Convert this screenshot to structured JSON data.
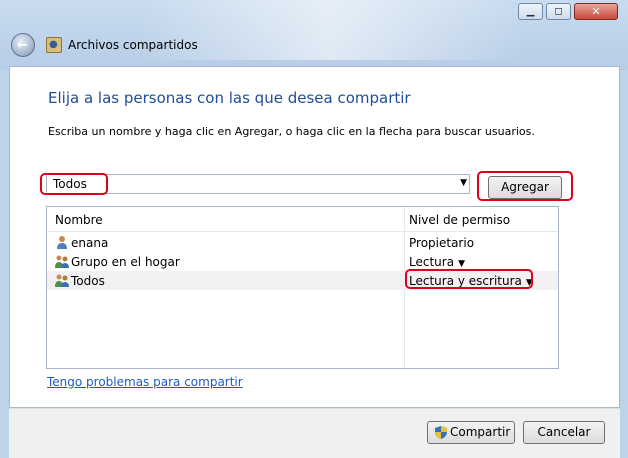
{
  "window": {
    "title": "Archivos compartidos",
    "buttons": {
      "minimize": "▁",
      "maximize": "◻",
      "close": "✕"
    }
  },
  "dialog": {
    "heading": "Elija a las personas con las que desea compartir",
    "description": "Escriba un nombre y haga clic en Agregar, o haga clic en la flecha para buscar usuarios.",
    "name_input": {
      "value": "Todos"
    },
    "add_button": "Agregar",
    "list": {
      "columns": {
        "name": "Nombre",
        "permission": "Nivel de permiso"
      },
      "rows": [
        {
          "icon": "user-icon",
          "name": "enana",
          "permission": "Propietario",
          "has_dropdown": false
        },
        {
          "icon": "group-icon",
          "name": "Grupo en el hogar",
          "permission": "Lectura",
          "has_dropdown": true,
          "caret": "▼"
        },
        {
          "icon": "group-icon",
          "name": "Todos",
          "permission": "Lectura y escritura",
          "has_dropdown": true,
          "caret": "▼"
        }
      ]
    },
    "help_link": "Tengo problemas para compartir"
  },
  "footer": {
    "share_button": "Compartir",
    "cancel_button": "Cancelar"
  },
  "colors": {
    "heading": "#1e4e9a",
    "link": "#1b5cc4",
    "annotation": "#e0001b"
  }
}
